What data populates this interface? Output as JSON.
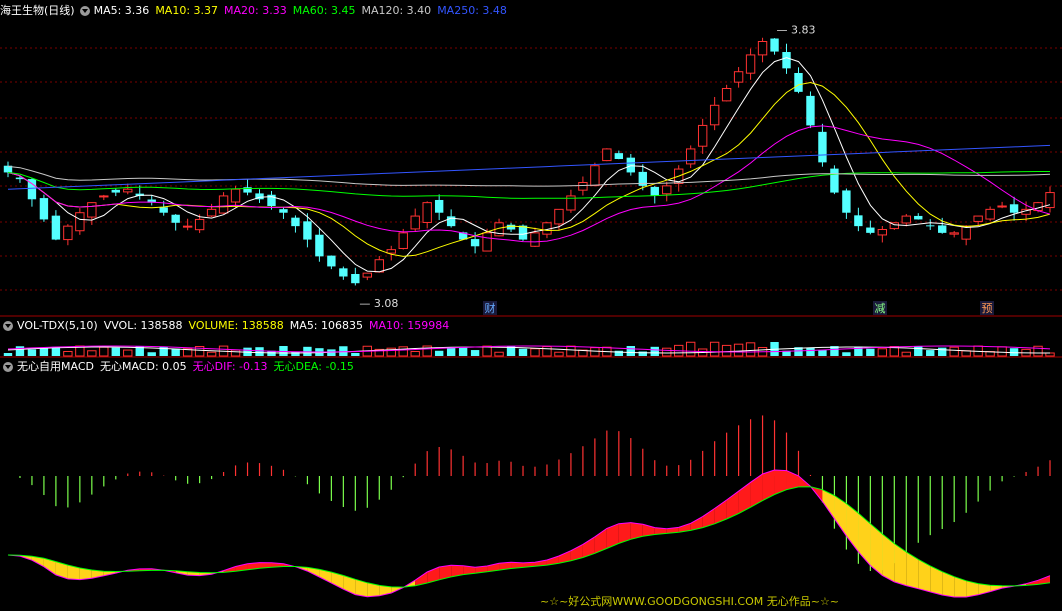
{
  "main_panel": {
    "title": "海王生物(日线)",
    "indicators": [
      {
        "label": "MA5: 3.36",
        "color": "#ffffff"
      },
      {
        "label": "MA10: 3.37",
        "color": "#ffff00"
      },
      {
        "label": "MA20: 3.33",
        "color": "#ff00ff"
      },
      {
        "label": "MA60: 3.45",
        "color": "#00ff00"
      },
      {
        "label": "MA120: 3.40",
        "color": "#c8c8c8"
      },
      {
        "label": "MA250: 3.48",
        "color": "#3355ff"
      }
    ],
    "high_marker": "3.83",
    "low_marker": "3.08",
    "event_labels": [
      {
        "text": "财",
        "color": "#66aaff"
      },
      {
        "text": "减",
        "color": "#88ff88"
      },
      {
        "text": "预",
        "color": "#ff9955"
      }
    ]
  },
  "volume_panel": {
    "title": "VOL-TDX(5,10)",
    "indicators": [
      {
        "label": "VVOL: 138588",
        "color": "#ffffff"
      },
      {
        "label": "VOLUME: 138588",
        "color": "#ffff00"
      },
      {
        "label": "MA5: 106835",
        "color": "#ffffff"
      },
      {
        "label": "MA10: 159984",
        "color": "#ff00ff"
      }
    ]
  },
  "macd_panel": {
    "title": "无心自用MACD",
    "indicators": [
      {
        "label": "无心MACD: 0.05",
        "color": "#ffffff"
      },
      {
        "label": "无心DIF: -0.13",
        "color": "#ff00ff"
      },
      {
        "label": "无心DEA: -0.15",
        "color": "#00ff00"
      }
    ]
  },
  "watermark": "~☆~好公式网WWW.GOODGONGSHI.COM 无心作品~☆~",
  "chart_data": {
    "type": "candlestick",
    "price_range": [
      3.08,
      3.83
    ],
    "close_series": [
      3.42,
      3.4,
      3.34,
      3.28,
      3.22,
      3.26,
      3.3,
      3.33,
      3.35,
      3.36,
      3.37,
      3.35,
      3.33,
      3.3,
      3.27,
      3.26,
      3.28,
      3.31,
      3.35,
      3.37,
      3.36,
      3.34,
      3.32,
      3.3,
      3.26,
      3.22,
      3.17,
      3.14,
      3.11,
      3.09,
      3.12,
      3.16,
      3.19,
      3.24,
      3.29,
      3.33,
      3.3,
      3.26,
      3.22,
      3.2,
      3.24,
      3.27,
      3.25,
      3.22,
      3.24,
      3.27,
      3.31,
      3.35,
      3.39,
      3.44,
      3.49,
      3.46,
      3.42,
      3.38,
      3.35,
      3.38,
      3.43,
      3.49,
      3.56,
      3.62,
      3.67,
      3.72,
      3.77,
      3.81,
      3.78,
      3.73,
      3.66,
      3.56,
      3.45,
      3.36,
      3.3,
      3.26,
      3.24,
      3.25,
      3.27,
      3.29,
      3.28,
      3.26,
      3.24,
      3.24,
      3.26,
      3.29,
      3.31,
      3.32,
      3.3,
      3.31,
      3.33,
      3.36
    ]
  }
}
